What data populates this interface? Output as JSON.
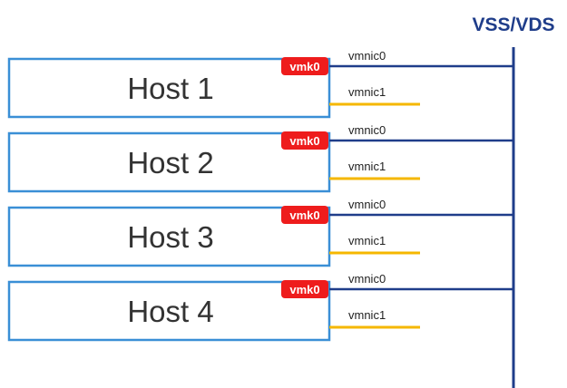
{
  "switch": {
    "label": "VSS/VDS"
  },
  "hosts": [
    {
      "name": "Host 1",
      "vmk": "vmk0",
      "nic_primary": "vmnic0",
      "nic_secondary": "vmnic1"
    },
    {
      "name": "Host 2",
      "vmk": "vmk0",
      "nic_primary": "vmnic0",
      "nic_secondary": "vmnic1"
    },
    {
      "name": "Host 3",
      "vmk": "vmk0",
      "nic_primary": "vmnic0",
      "nic_secondary": "vmnic1"
    },
    {
      "name": "Host 4",
      "vmk": "vmk0",
      "nic_primary": "vmnic0",
      "nic_secondary": "vmnic1"
    }
  ],
  "colors": {
    "host_border": "#3a8fd6",
    "switch_line": "#1f3d8a",
    "switch_title": "#1f3d8a",
    "standby_link": "#f5b700",
    "vmk_badge": "#ee1c1c",
    "vmk_text": "#ffffff",
    "host_text": "#333333",
    "nic_text": "#222222"
  }
}
